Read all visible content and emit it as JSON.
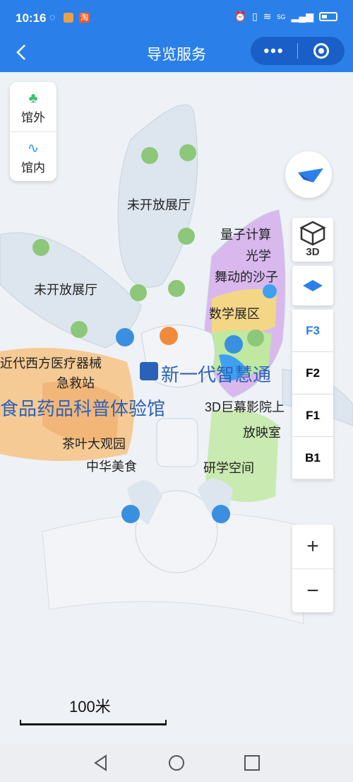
{
  "status_bar": {
    "time": "10:16",
    "left_icons": [
      "chat-bubble-icon",
      "app-icon",
      "taobao-icon"
    ],
    "taobao_badge": "淘",
    "network": "5G"
  },
  "nav": {
    "title": "导览服务",
    "back_icon": "chevron-left-icon",
    "more_icon": "more-dots-icon",
    "close_icon": "target-icon",
    "more_glyph": "•••"
  },
  "venue_toggle": {
    "outside_label": "馆外",
    "inside_label": "馆内"
  },
  "map": {
    "labels": [
      {
        "id": "closed-hall-1",
        "text": "未开放展厅"
      },
      {
        "id": "closed-hall-2",
        "text": "未开放展厅"
      },
      {
        "id": "quantum",
        "text": "量子计算"
      },
      {
        "id": "optics",
        "text": "光学"
      },
      {
        "id": "sand",
        "text": "舞动的沙子"
      },
      {
        "id": "math",
        "text": "数学展区"
      },
      {
        "id": "medical",
        "text": "近代西方医疗器械"
      },
      {
        "id": "first-aid",
        "text": "急救站"
      },
      {
        "id": "food-drug",
        "text": "食品药品科普体验馆"
      },
      {
        "id": "new-gen",
        "text": "新一代智慧通"
      },
      {
        "id": "imax",
        "text": "3D巨幕影院上"
      },
      {
        "id": "screening",
        "text": "放映室"
      },
      {
        "id": "tea",
        "text": "茶叶大观园"
      },
      {
        "id": "food",
        "text": "中华美食"
      },
      {
        "id": "study",
        "text": "研学空间"
      }
    ],
    "colors": {
      "hall": "#dde6ef",
      "floor": "#f3f4f7",
      "exhibit_purple": "#d9b8ee",
      "exhibit_green": "#bfe8a0",
      "exhibit_blue": "#3fa0f2",
      "exhibit_orange": "#f5c58a",
      "accent": "#2a80e8"
    }
  },
  "controls": {
    "compass_icon": "compass-icon",
    "view_3d_label": "3D",
    "view_2d_icon": "layer-2d-icon",
    "floors": [
      {
        "label": "F3",
        "active": true
      },
      {
        "label": "F2",
        "active": false
      },
      {
        "label": "F1",
        "active": false
      },
      {
        "label": "B1",
        "active": false
      }
    ],
    "zoom_in": "+",
    "zoom_out": "−"
  },
  "scale": {
    "label": "100米"
  }
}
